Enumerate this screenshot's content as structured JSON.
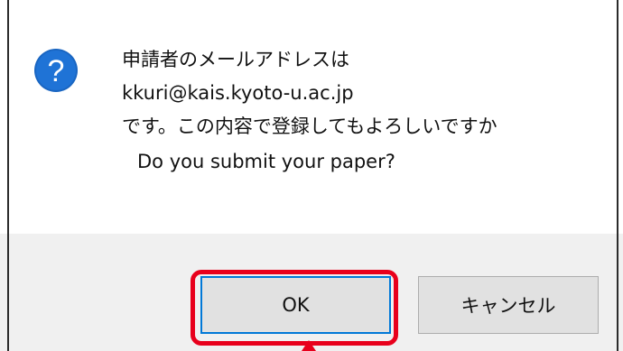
{
  "dialog": {
    "icon": "question-icon",
    "icon_glyph": "?",
    "message_lines": [
      "申請者のメールアドレスは",
      "kkuri@kais.kyoto-u.ac.jp",
      "です。この内容で登録してもよろしいですか",
      "Do you submit your paper?"
    ]
  },
  "buttons": {
    "ok_label": "OK",
    "cancel_label": "キャンセル"
  },
  "colors": {
    "icon_blue": "#1a66c2",
    "focus_blue": "#0078d7",
    "highlight_red": "#e8001c",
    "footer_gray": "#f0f0f0",
    "button_gray": "#e1e1e1"
  }
}
